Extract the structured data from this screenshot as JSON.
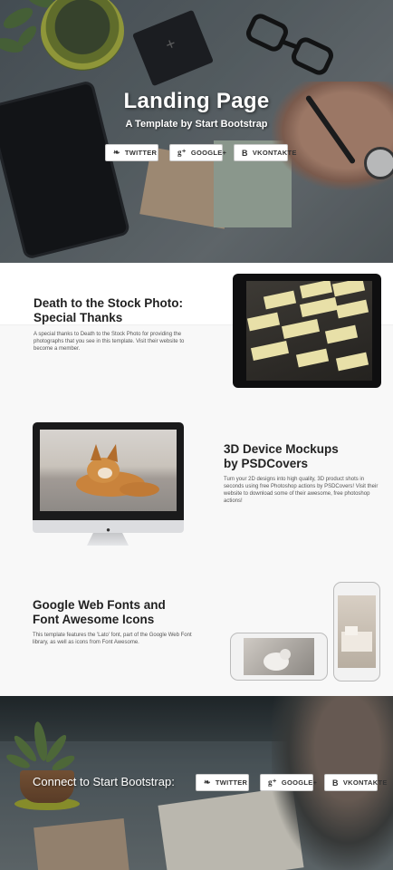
{
  "hero": {
    "title": "Landing Page",
    "subtitle": "A Template by Start Bootstrap",
    "buttons": [
      {
        "icon": "twitter-icon",
        "label": "TWITTER"
      },
      {
        "icon": "google-plus-icon",
        "label": "GOOGLE+"
      },
      {
        "icon": "vkontakte-icon",
        "label": "VKONTAKTE"
      }
    ]
  },
  "section1": {
    "heading_line1": "Death to the Stock Photo:",
    "heading_line2": "Special Thanks",
    "body": "A special thanks to Death to the Stock Photo for providing the photographs that you see in this template. Visit their website to become a member."
  },
  "section2": {
    "heading_line1": "3D Device Mockups",
    "heading_line2": "by PSDCovers",
    "body": "Turn your 2D designs into high quality, 3D product shots in seconds using free Photoshop actions by PSDCovers! Visit their website to download some of their awesome, free photoshop actions!"
  },
  "section3": {
    "heading_line1": "Google Web Fonts and",
    "heading_line2": "Font Awesome Icons",
    "body": "This template features the 'Lato' font, part of the Google Web Font library, as well as icons from Font Awesome."
  },
  "footer": {
    "cta": "Connect to Start Bootstrap:",
    "buttons": [
      {
        "icon": "twitter-icon",
        "label": "TWITTER"
      },
      {
        "icon": "google-plus-icon",
        "label": "GOOGLE+"
      },
      {
        "icon": "vkontakte-icon",
        "label": "VKONTAKTE"
      }
    ]
  },
  "icons": {
    "twitter": "❧",
    "google": "g⁺",
    "vk": "B",
    "apple": ""
  },
  "colors": {
    "text_dark": "#222222",
    "section_bg": "#f8f8f8",
    "button_bg": "#ffffff"
  }
}
